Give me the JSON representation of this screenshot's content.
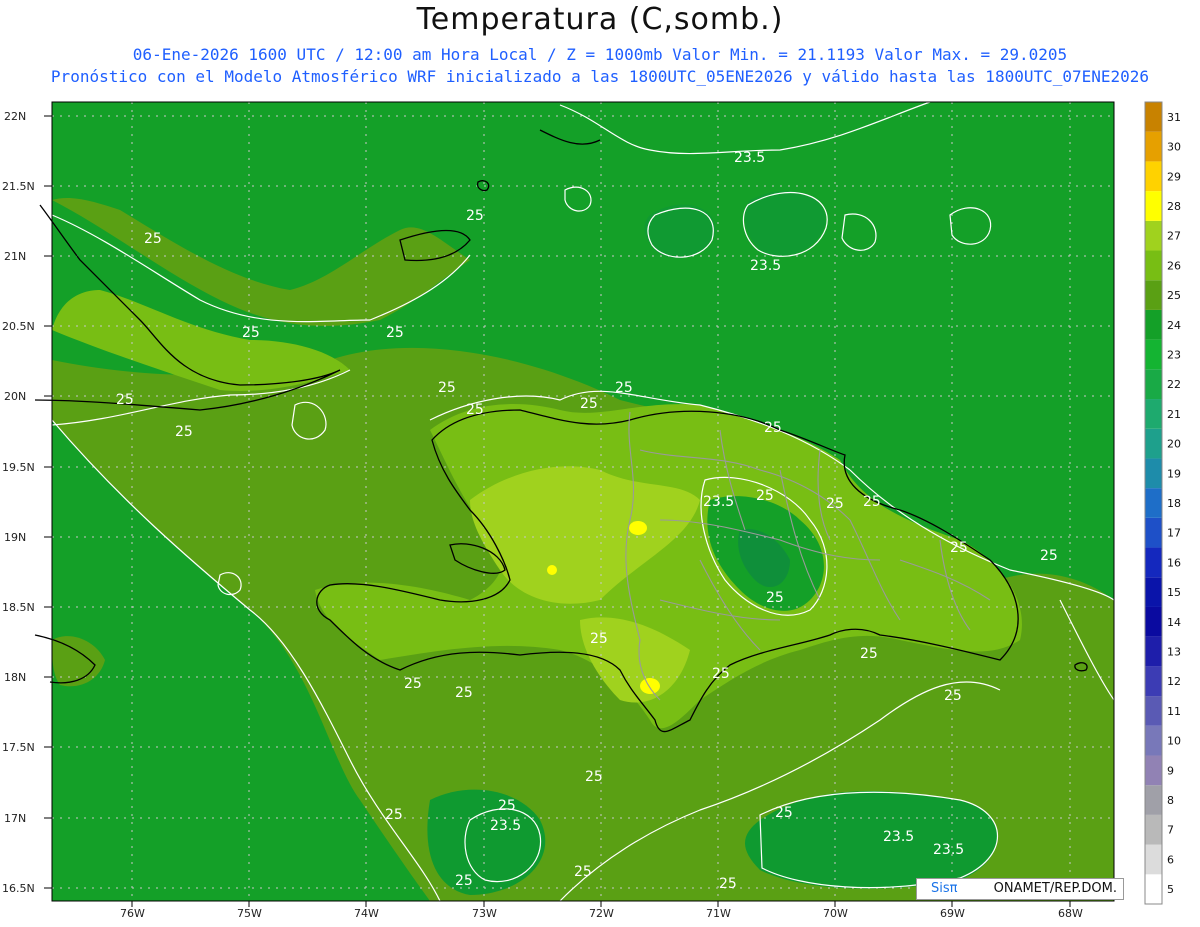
{
  "header": {
    "title": "Temperatura (C,somb.)",
    "line1": "06-Ene-2026 1600 UTC / 12:00 am Hora Local / Z = 1000mb  Valor Min. = 21.1193  Valor Max. = 29.0205",
    "line2": "Pronóstico con el Modelo Atmosférico WRF inicializado a las 1800UTC_05ENE2026 y válido hasta las  1800UTC_07ENE2026"
  },
  "axes": {
    "lat_labels": [
      "22N",
      "21.5N",
      "21N",
      "20.5N",
      "20N",
      "19.5N",
      "19N",
      "18.5N",
      "18N",
      "17.5N",
      "17N",
      "16.5N"
    ],
    "lon_labels": [
      "76W",
      "75W",
      "74W",
      "73W",
      "72W",
      "71W",
      "70W",
      "69W",
      "68W"
    ]
  },
  "colorbar": {
    "levels": [
      "5",
      "6",
      "7",
      "8",
      "9",
      "10",
      "11",
      "12",
      "13",
      "14",
      "15",
      "16",
      "17",
      "18",
      "19",
      "20",
      "21",
      "22",
      "23",
      "24",
      "25",
      "26",
      "27",
      "28",
      "29",
      "30",
      "31"
    ],
    "colors": [
      "#ffffff",
      "#dcdcdc",
      "#b9b9b9",
      "#a0a0a8",
      "#9182b4",
      "#7878b9",
      "#5a5ab4",
      "#3c3cb4",
      "#1e1eaa",
      "#0a0aa0",
      "#0a14aa",
      "#1428be",
      "#1e50c8",
      "#1e6ec8",
      "#1e8caa",
      "#1ea08c",
      "#1eaa6e",
      "#19aa46",
      "#14b432",
      "#14a028",
      "#5aa014",
      "#78be14",
      "#a0d21e",
      "#ffff00",
      "#ffd200",
      "#e6a000",
      "#c88200"
    ]
  },
  "contours": {
    "labels": [
      "23.5",
      "23.5",
      "25",
      "25",
      "25",
      "25",
      "25",
      "25",
      "25",
      "25",
      "25",
      "25",
      "25",
      "25",
      "23.5",
      "25",
      "25",
      "25",
      "25",
      "25",
      "25",
      "25",
      "25",
      "25",
      "25",
      "25",
      "25",
      "25",
      "23.5",
      "25",
      "25",
      "23.5",
      "23.5",
      "25",
      "25",
      "25"
    ]
  },
  "footer": {
    "logo_sis": "Sisπ",
    "logo_org": "ONAMET/REP.DOM."
  },
  "colors": {
    "sea": "#14a028",
    "land_low": "#5aa014",
    "land_mid": "#78be14",
    "land_hot": "#a0d21e",
    "land_hotspot": "#ffff00",
    "cool_patch": "#1a9a3a",
    "contour": "#ffffff",
    "coast": "#000000",
    "border": "#9a9a9a"
  }
}
